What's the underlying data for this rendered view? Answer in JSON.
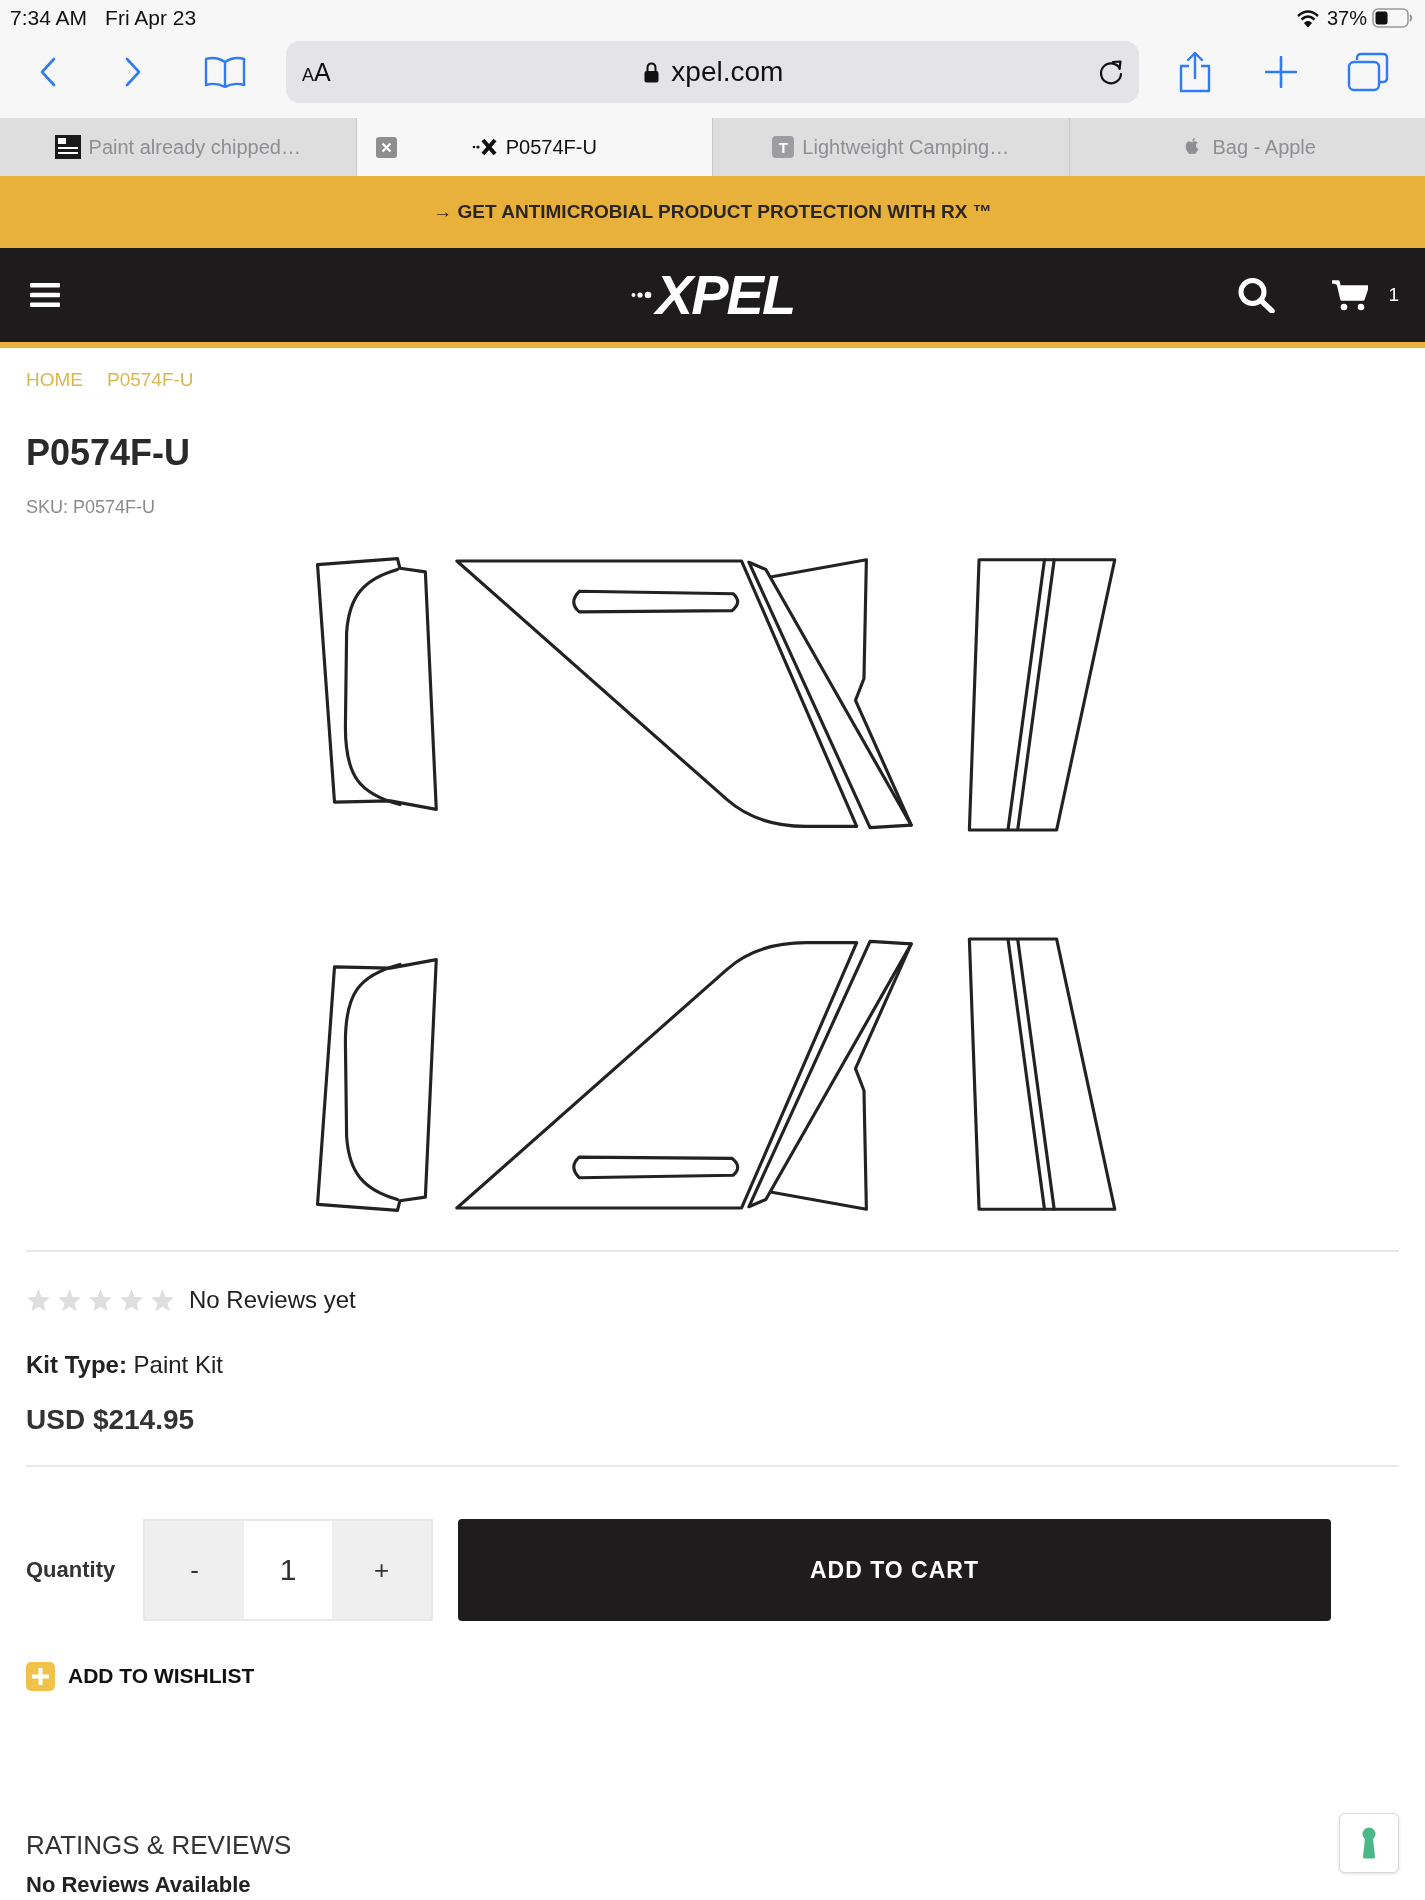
{
  "status_bar": {
    "time": "7:34 AM",
    "date": "Fri Apr 23",
    "battery": "37%"
  },
  "toolbar": {
    "text_size_label": "AA",
    "url": "xpel.com"
  },
  "tabs": [
    {
      "title": "Paint already chipped…",
      "selected": false
    },
    {
      "title": "P0574F-U",
      "selected": true
    },
    {
      "title": "Lightweight Camping…",
      "selected": false,
      "favicon_letter": "T"
    },
    {
      "title": "Bag - Apple",
      "selected": false
    }
  ],
  "banner": {
    "text": "→ GET ANTIMICROBIAL PRODUCT PROTECTION WITH RX ™"
  },
  "nav": {
    "logo": "XPEL",
    "cart_count": "1"
  },
  "breadcrumb": [
    {
      "label": "HOME"
    },
    {
      "label": "P0574F-U"
    }
  ],
  "product": {
    "title": "P0574F-U",
    "sku": "SKU: P0574F-U",
    "stars": 0,
    "reviews_text": "No Reviews yet",
    "kit_type": "**Kit Type:** Paint Kit",
    "price": "USD $214.95"
  },
  "purchase": {
    "quantity_label": "Quantity",
    "decrement": "-",
    "quantity": "1",
    "increment": "+",
    "add_to_cart": "ADD TO CART",
    "wishlist": "ADD TO WISHLIST"
  },
  "reviews_section": {
    "heading": "RATINGS & REVIEWS",
    "empty_text": "No Reviews Available"
  }
}
